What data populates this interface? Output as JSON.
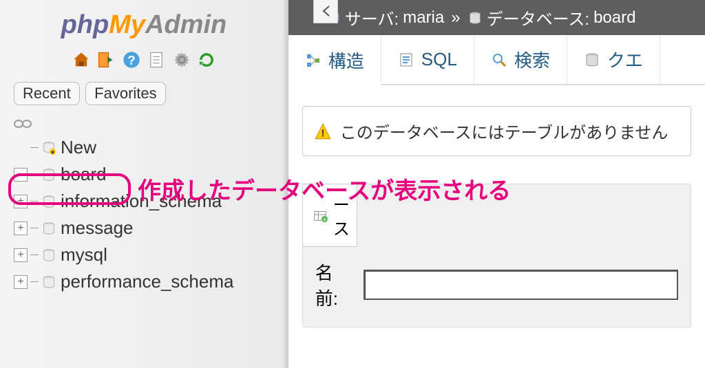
{
  "logo": {
    "part1": "php",
    "part2": "My",
    "part3": "Admin"
  },
  "sidebar_tabs": {
    "recent": "Recent",
    "favorites": "Favorites"
  },
  "tree": {
    "new": "New",
    "items": [
      {
        "label": "board"
      },
      {
        "label": "information_schema"
      },
      {
        "label": "message"
      },
      {
        "label": "mysql"
      },
      {
        "label": "performance_schema"
      }
    ]
  },
  "annotation": "作成したデータベースが表示される",
  "breadcrumb": {
    "server_label": "サーバ:",
    "server_name": "maria",
    "db_label": "データベース:",
    "db_name": "board"
  },
  "top_tabs": {
    "structure": "構造",
    "sql": "SQL",
    "search": "検索",
    "query": "クエ"
  },
  "warning": "このデータベースにはテーブルがありません",
  "create": {
    "header": "ース",
    "name_label": "名前:"
  }
}
